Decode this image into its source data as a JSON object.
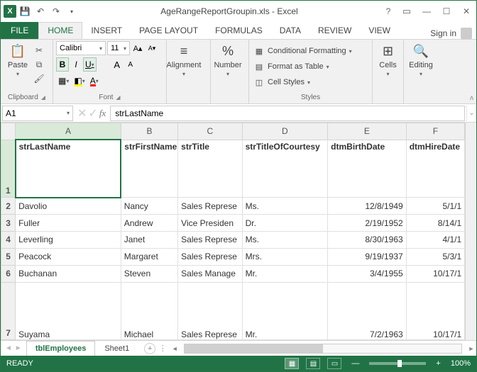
{
  "titlebar": {
    "title": "AgeRangeReportGroupin.xls - Excel",
    "signin": "Sign in"
  },
  "tabs": {
    "file": "FILE",
    "items": [
      "HOME",
      "INSERT",
      "PAGE LAYOUT",
      "FORMULAS",
      "DATA",
      "REVIEW",
      "VIEW"
    ],
    "active": "HOME"
  },
  "ribbon": {
    "clipboard": {
      "label": "Clipboard",
      "paste": "Paste"
    },
    "font": {
      "label": "Font",
      "name": "Calibri",
      "size": "11"
    },
    "alignment": {
      "label": "Alignment"
    },
    "number": {
      "label": "Number"
    },
    "styles": {
      "label": "Styles",
      "conditional": "Conditional Formatting",
      "table": "Format as Table",
      "cell": "Cell Styles"
    },
    "cells": {
      "label": "Cells"
    },
    "editing": {
      "label": "Editing"
    }
  },
  "namebox": "A1",
  "formula": "strLastName",
  "columns": [
    "A",
    "B",
    "C",
    "D",
    "E",
    "F"
  ],
  "headers": [
    "strLastName",
    "strFirstName",
    "strTitle",
    "strTitleOfCourtesy",
    "dtmBirthDate",
    "dtmHireDate"
  ],
  "rows": [
    {
      "n": "2",
      "c": [
        "Davolio",
        "Nancy",
        "Sales Represe",
        "Ms.",
        "12/8/1949",
        "5/1/1"
      ]
    },
    {
      "n": "3",
      "c": [
        "Fuller",
        "Andrew",
        "Vice Presiden",
        "Dr.",
        "2/19/1952",
        "8/14/1"
      ]
    },
    {
      "n": "4",
      "c": [
        "Leverling",
        "Janet",
        "Sales Represe",
        "Ms.",
        "8/30/1963",
        "4/1/1"
      ]
    },
    {
      "n": "5",
      "c": [
        "Peacock",
        "Margaret",
        "Sales Represe",
        "Mrs.",
        "9/19/1937",
        "5/3/1"
      ]
    },
    {
      "n": "6",
      "c": [
        "Buchanan",
        "Steven",
        "Sales Manage",
        "Mr.",
        "3/4/1955",
        "10/17/1"
      ]
    }
  ],
  "row7": {
    "n": "7",
    "c": [
      "Suyama",
      "Michael",
      "Sales Represe",
      "Mr.",
      "7/2/1963",
      "10/17/1"
    ]
  },
  "sheets": {
    "active": "tblEmployees",
    "other": "Sheet1"
  },
  "status": {
    "ready": "READY",
    "zoom": "100%"
  }
}
